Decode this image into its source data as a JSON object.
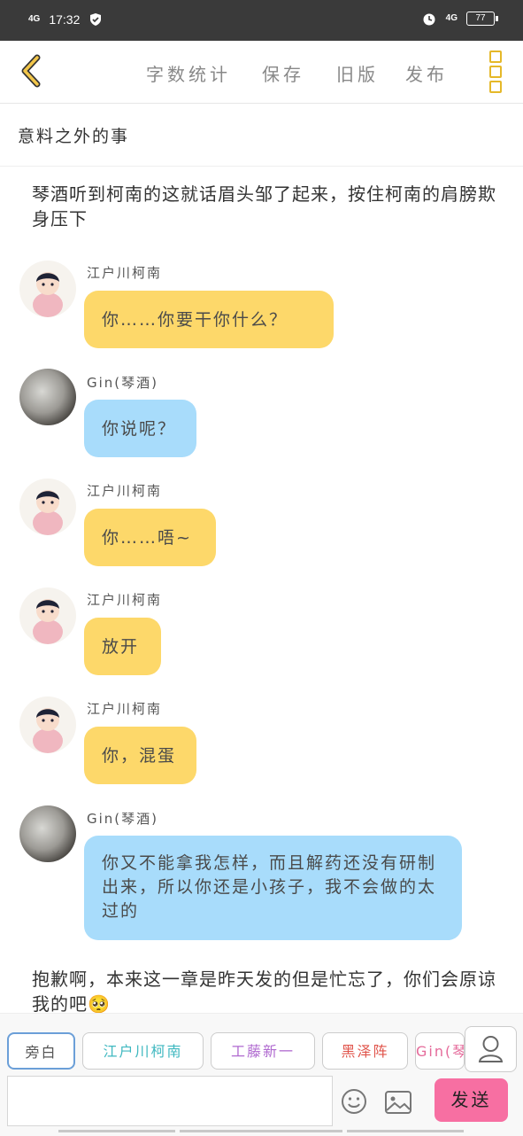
{
  "status": {
    "time": "17:32",
    "network_left": "4G",
    "network_right": "4G",
    "battery": "77"
  },
  "toolbar": {
    "word_count": "字数统计",
    "save": "保存",
    "old_version": "旧版",
    "publish": "发布"
  },
  "story_title": "意料之外的事",
  "narration_1": "琴酒听到柯南的这就话眉头邹了起来，按住柯南的肩膀欺身压下",
  "messages": [
    {
      "speaker": "江户川柯南",
      "text": "你……你要干你什么？"
    },
    {
      "speaker": "Gin(琴酒)",
      "text": "你说呢？"
    },
    {
      "speaker": "江户川柯南",
      "text": "你……唔~"
    },
    {
      "speaker": "江户川柯南",
      "text": "放开"
    },
    {
      "speaker": "江户川柯南",
      "text": "你，混蛋"
    },
    {
      "speaker": "Gin(琴酒)",
      "text": "你又不能拿我怎样，而且解药还没有研制出来，所以你还是小孩子，我不会做的太过的"
    }
  ],
  "narration_2": "抱歉啊，本来这一章是昨天发的但是忙忘了，你们会原谅我的吧🥺",
  "roles": [
    {
      "label": "旁白",
      "color": "#555555"
    },
    {
      "label": "江户川柯南",
      "color": "#3fb8c0"
    },
    {
      "label": "工藤新一",
      "color": "#b06ad0"
    },
    {
      "label": "黑泽阵",
      "color": "#e0534a"
    },
    {
      "label": "Gin(琴酒)",
      "color": "#e56a9a"
    }
  ],
  "send_label": "发送",
  "colors": {
    "user_bubble": "#fdd86a",
    "other_bubble": "#a8dcfb",
    "send": "#f76fa2",
    "accent": "#e5b829"
  }
}
